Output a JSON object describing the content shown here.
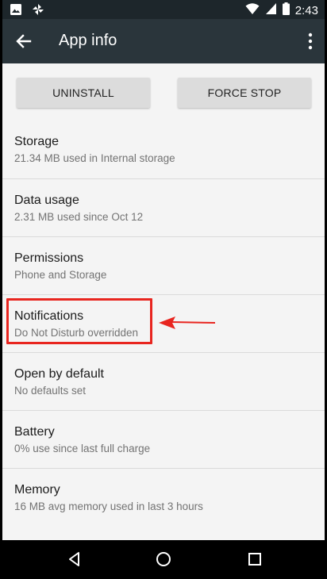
{
  "status_bar": {
    "time": "2:43",
    "icons": [
      "image-icon",
      "pinwheel-icon",
      "wifi-icon",
      "cell-signal-icon",
      "battery-icon"
    ]
  },
  "app_bar": {
    "title": "App info",
    "back_icon": "arrow-back-icon",
    "menu_icon": "more-vert-icon"
  },
  "buttons": {
    "uninstall": "UNINSTALL",
    "force_stop": "FORCE STOP"
  },
  "items": [
    {
      "title": "Storage",
      "subtitle": "21.34 MB used in Internal storage"
    },
    {
      "title": "Data usage",
      "subtitle": "2.31 MB used since Oct 12"
    },
    {
      "title": "Permissions",
      "subtitle": "Phone and Storage"
    },
    {
      "title": "Notifications",
      "subtitle": "Do Not Disturb overridden"
    },
    {
      "title": "Open by default",
      "subtitle": "No defaults set"
    },
    {
      "title": "Battery",
      "subtitle": "0% use since last full charge"
    },
    {
      "title": "Memory",
      "subtitle": "16 MB avg memory used in last 3 hours"
    }
  ],
  "annotation": {
    "highlight_color": "#e8251f",
    "target_item": "Notifications"
  },
  "colors": {
    "status_bar_bg": "#1d262b",
    "app_bar_bg": "#2a353b",
    "page_bg": "#f4f4f4",
    "button_bg": "#dcdcdc"
  },
  "nav_bar": {
    "icons": [
      "back-triangle-icon",
      "home-circle-icon",
      "recents-square-icon"
    ]
  }
}
